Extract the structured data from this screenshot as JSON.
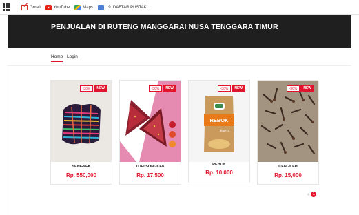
{
  "bookmarks": [
    {
      "label": "Gmail",
      "icon": "gmail-icon"
    },
    {
      "label": "YouTube",
      "icon": "youtube-icon"
    },
    {
      "label": "Maps",
      "icon": "maps-icon"
    },
    {
      "label": "19. DAFTAR PUSTAK...",
      "icon": "document-icon"
    }
  ],
  "header": {
    "title": "PENJUALAN DI RUTENG MANGGARAI NUSA TENGGARA TIMUR"
  },
  "nav": {
    "home": "Home",
    "login": "Login"
  },
  "products": [
    {
      "name": "SENGKEK",
      "price": "Rp. 550,000",
      "discount": "-30%",
      "badge": "NEW"
    },
    {
      "name": "TOPI SONGKEK",
      "price": "Rp. 17,500",
      "discount": "-30%",
      "badge": "NEW"
    },
    {
      "name": "REBOK",
      "price": "Rp. 10,000",
      "discount": "-30%",
      "badge": "NEW",
      "package_label": "REBOK",
      "package_sub": "Sagera"
    },
    {
      "name": "CENGKEH",
      "price": "Rp. 15,000",
      "discount": "-30%",
      "badge": "NEW"
    }
  ],
  "pagination": {
    "prev": "‹",
    "current": "1"
  },
  "colors": {
    "accent": "#e2142d",
    "header_bg": "#1f1f1f"
  }
}
